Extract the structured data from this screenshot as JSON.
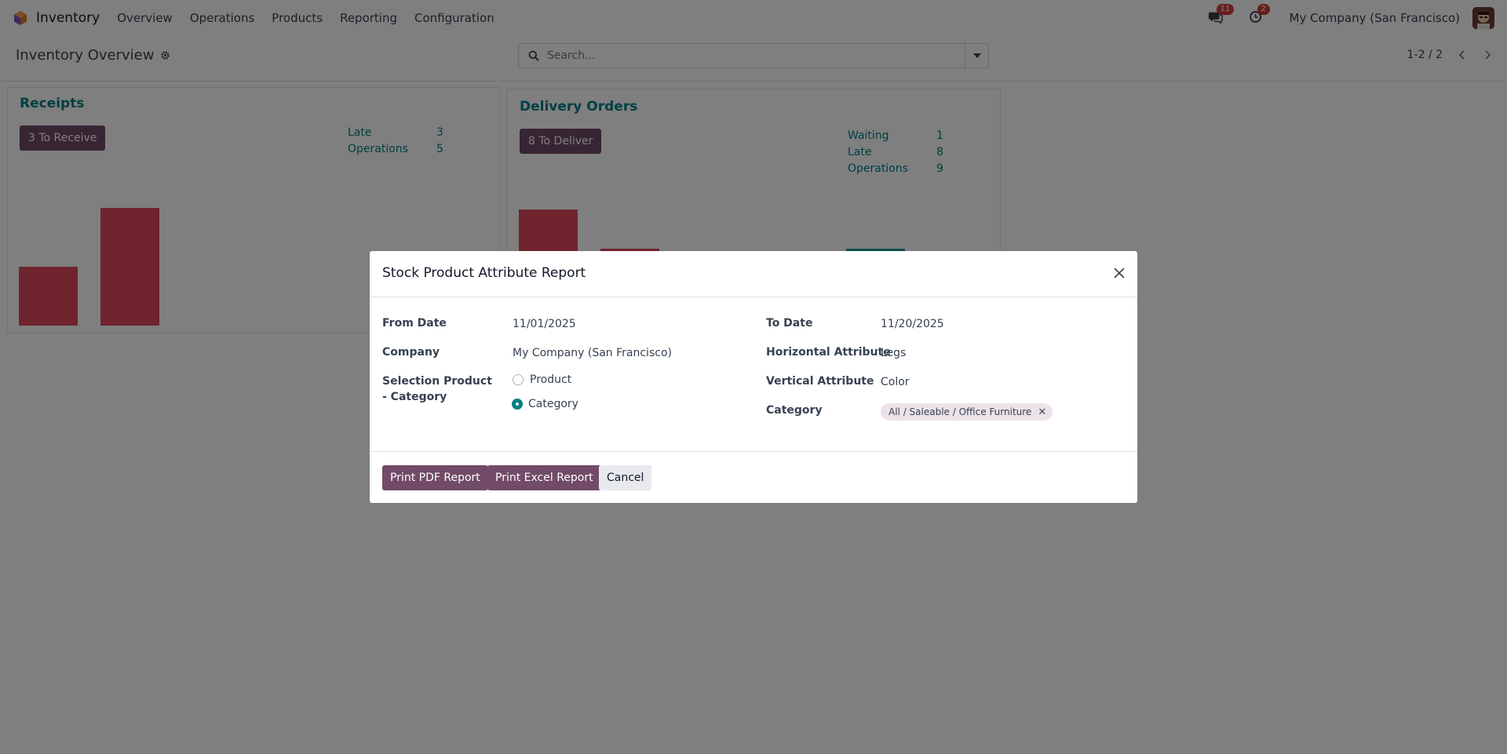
{
  "app": {
    "name": "Inventory"
  },
  "nav": {
    "items": [
      "Overview",
      "Operations",
      "Products",
      "Reporting",
      "Configuration"
    ],
    "messages_count": "11",
    "activities_count": "2",
    "company": "My Company (San Francisco)"
  },
  "control_panel": {
    "title": "Inventory Overview",
    "search_placeholder": "Search...",
    "pager": "1-2 / 2"
  },
  "cards": [
    {
      "title": "Receipts",
      "button": "3 To Receive",
      "stats": [
        {
          "label": "Late",
          "value": "3"
        },
        {
          "label": "Operations",
          "value": "5"
        }
      ]
    },
    {
      "title": "Delivery Orders",
      "button": "8 To Deliver",
      "stats": [
        {
          "label": "Waiting",
          "value": "1"
        },
        {
          "label": "Late",
          "value": "8"
        },
        {
          "label": "Operations",
          "value": "9"
        }
      ]
    }
  ],
  "dialog": {
    "title": "Stock Product Attribute Report",
    "from_date_label": "From Date",
    "from_date": "11/01/2025",
    "to_date_label": "To Date",
    "to_date": "11/20/2025",
    "company_label": "Company",
    "company": "My Company (San Francisco)",
    "horizontal_label": "Horizontal Attribute",
    "horizontal": "Legs",
    "selection_label": "Selection Product - Category",
    "radio_product": "Product",
    "radio_category": "Category",
    "radio_selected": "Category",
    "vertical_label": "Vertical Attribute",
    "vertical": "Color",
    "category_label": "Category",
    "category_tag": "All / Saleable / Office Furniture",
    "tag_remove": "✕",
    "buttons": {
      "pdf": "Print PDF Report",
      "excel": "Print Excel Report",
      "cancel": "Cancel"
    }
  },
  "colors": {
    "brand": "#714b67",
    "link": "#017e84",
    "bar": "#e0485c",
    "bar_alt": "#1c9a8c"
  }
}
